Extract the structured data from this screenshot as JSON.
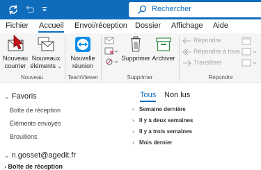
{
  "search": {
    "placeholder": "Rechercher"
  },
  "menu": {
    "tabs": [
      {
        "label": "Fichier"
      },
      {
        "label": "Accueil"
      },
      {
        "label": "Envoi/réception"
      },
      {
        "label": "Dossier"
      },
      {
        "label": "Affichage"
      },
      {
        "label": "Aide"
      }
    ],
    "active": "Accueil"
  },
  "ribbon": {
    "new_mail": [
      "Nouveau",
      "courrier"
    ],
    "new_items": [
      "Nouveaux",
      "éléments"
    ],
    "new_meeting": [
      "Nouvelle",
      "réunion"
    ],
    "delete": "Supprimer",
    "archive": "Archiver",
    "reply": "Répondre",
    "reply_all": "Répondre à tous",
    "forward": "Transférer",
    "groups": {
      "new": "Nouveau",
      "teamviewer": "TeamViewer",
      "delete": "Supprimer",
      "respond": "Répondre"
    }
  },
  "favorites": {
    "title": "Favoris",
    "folders": [
      "Boîte de réception",
      "Éléments envoyés",
      "Brouillons"
    ]
  },
  "account": {
    "email": "n.gosset@agedit.fr",
    "inbox": "Boîte de réception"
  },
  "mail_list": {
    "tabs": {
      "all": "Tous",
      "unread": "Non lus"
    },
    "groups": [
      "Semaine dernière",
      "Il y a deux semaines",
      "Il y a trois semaines",
      "Mois dernier"
    ]
  },
  "colors": {
    "accent": "#0f6cbd",
    "teamviewer": "#0e8ee9",
    "delete_red": "#c4314b",
    "archive_green": "#2f8f46"
  }
}
